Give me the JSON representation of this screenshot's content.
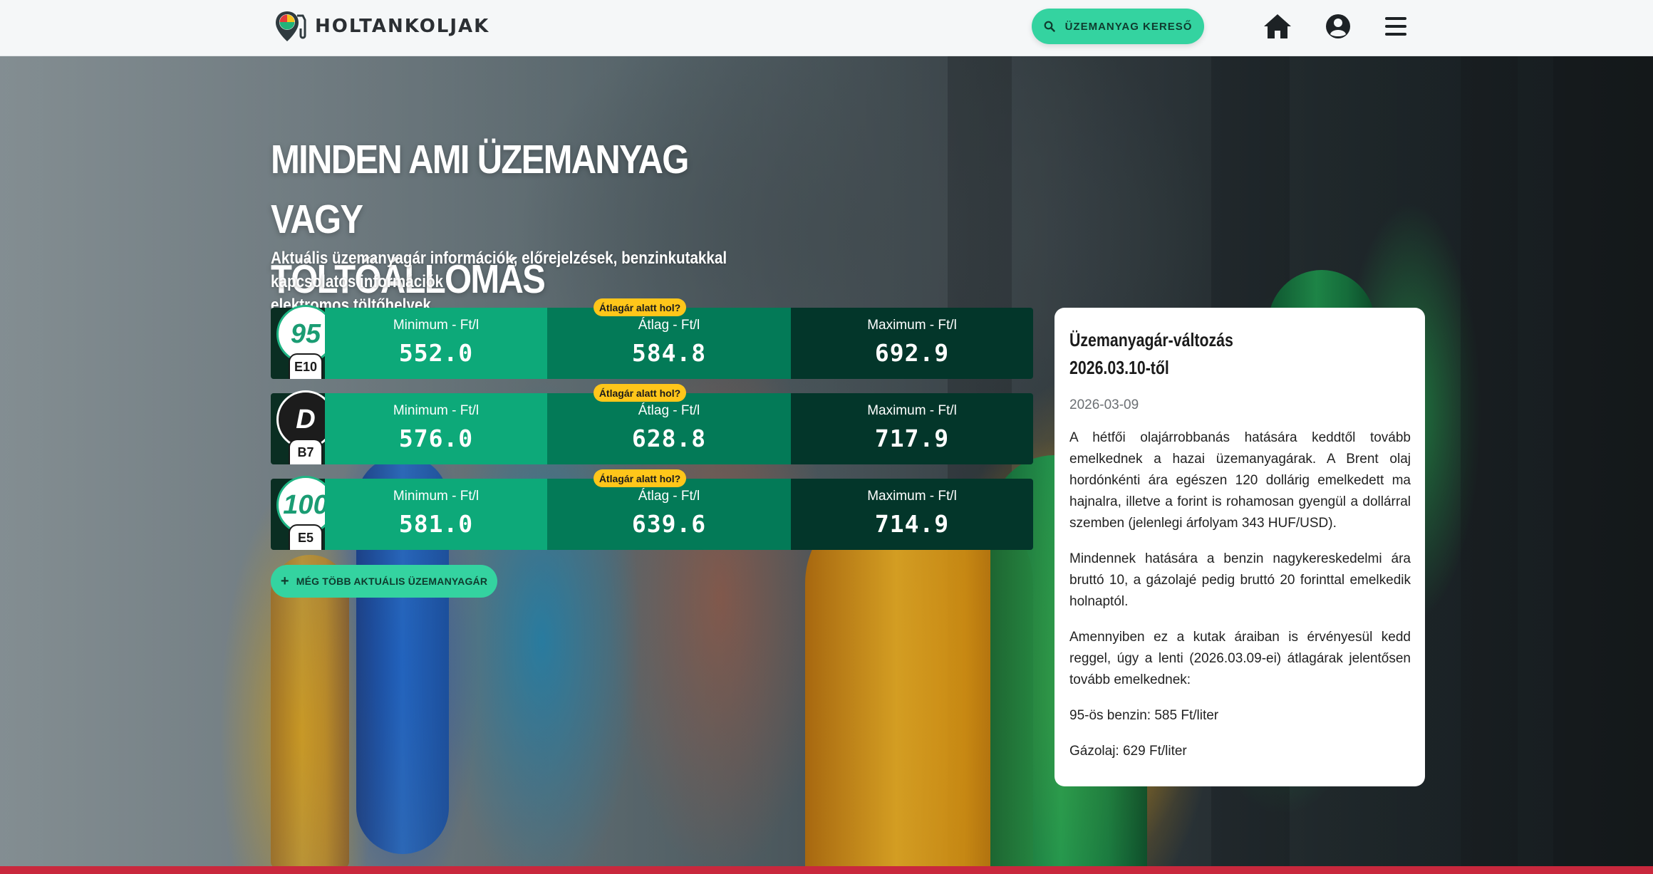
{
  "header": {
    "logo_text": "HOLTANKOLJAK",
    "search_button_label": "ÜZEMANYAG KERESŐ",
    "icons": [
      "search-icon",
      "home-icon",
      "user-icon",
      "menu-icon"
    ]
  },
  "hero": {
    "headline_line1": "MINDEN AMI ÜZEMANYAG VAGY",
    "headline_line2": "TÖLTŐÁLLOMÁS",
    "subline_line1": "Aktuális üzemanyagár információk, előrejelzések, benzinkutakkal kapcsolatos információk",
    "subline_line2": "elektromos töltőhelyek."
  },
  "prices": [
    {
      "badge": "95",
      "tag": "E10",
      "min_label": "Minimum - Ft/l",
      "min": "552.0",
      "avg_label": "Átlag - Ft/l",
      "avg": "584.8",
      "max_label": "Maximum - Ft/l",
      "max": "692.9",
      "below_avg": "Átlagár alatt hol?"
    },
    {
      "badge": "D",
      "tag": "B7",
      "min_label": "Minimum - Ft/l",
      "min": "576.0",
      "avg_label": "Átlag - Ft/l",
      "avg": "628.8",
      "max_label": "Maximum - Ft/l",
      "max": "717.9",
      "below_avg": "Átlagár alatt hol?"
    },
    {
      "badge": "100",
      "tag": "E5",
      "min_label": "Minimum - Ft/l",
      "min": "581.0",
      "avg_label": "Átlag - Ft/l",
      "avg": "639.6",
      "max_label": "Maximum - Ft/l",
      "max": "714.9",
      "below_avg": "Átlagár alatt hol?"
    }
  ],
  "more_button": {
    "icon": "+",
    "label": "MÉG TÖBB AKTUÁLIS ÜZEMANYAGÁR"
  },
  "news": {
    "title_line1": "Üzemanyagár-változás",
    "title_line2": "2026.03.10-től",
    "date": "2026-03-09",
    "paragraphs": [
      "A hétfői olajárrobbanás hatására keddtől tovább emelkednek a hazai üzemanyagárak. A Brent olaj hordónkénti ára egészen 120 dollárig emelkedett ma hajnalra, illetve a forint is rohamosan gyengül a dollárral szemben (jelenlegi árfolyam 343 HUF/USD).",
      "Mindennek hatására a benzin nagykereskedelmi ára bruttó 10, a gázolajé pedig bruttó 20 forinttal emelkedik holnaptól.",
      "Amennyiben ez a kutak áraiban is érvényesül kedd reggel, úgy a lenti (2026.03.09-ei) átlagárak jelentősen tovább emelkednek:",
      "95-ös benzin: 585 Ft/liter",
      "Gázolaj: 629 Ft/liter"
    ]
  },
  "colors": {
    "accent": "#34d3a0",
    "min_cell": "#0da979",
    "avg_cell": "#037a57",
    "max_cell": "#03362a",
    "badge_yellow": "#ffc61a",
    "bottom_strip": "#c9283d"
  }
}
